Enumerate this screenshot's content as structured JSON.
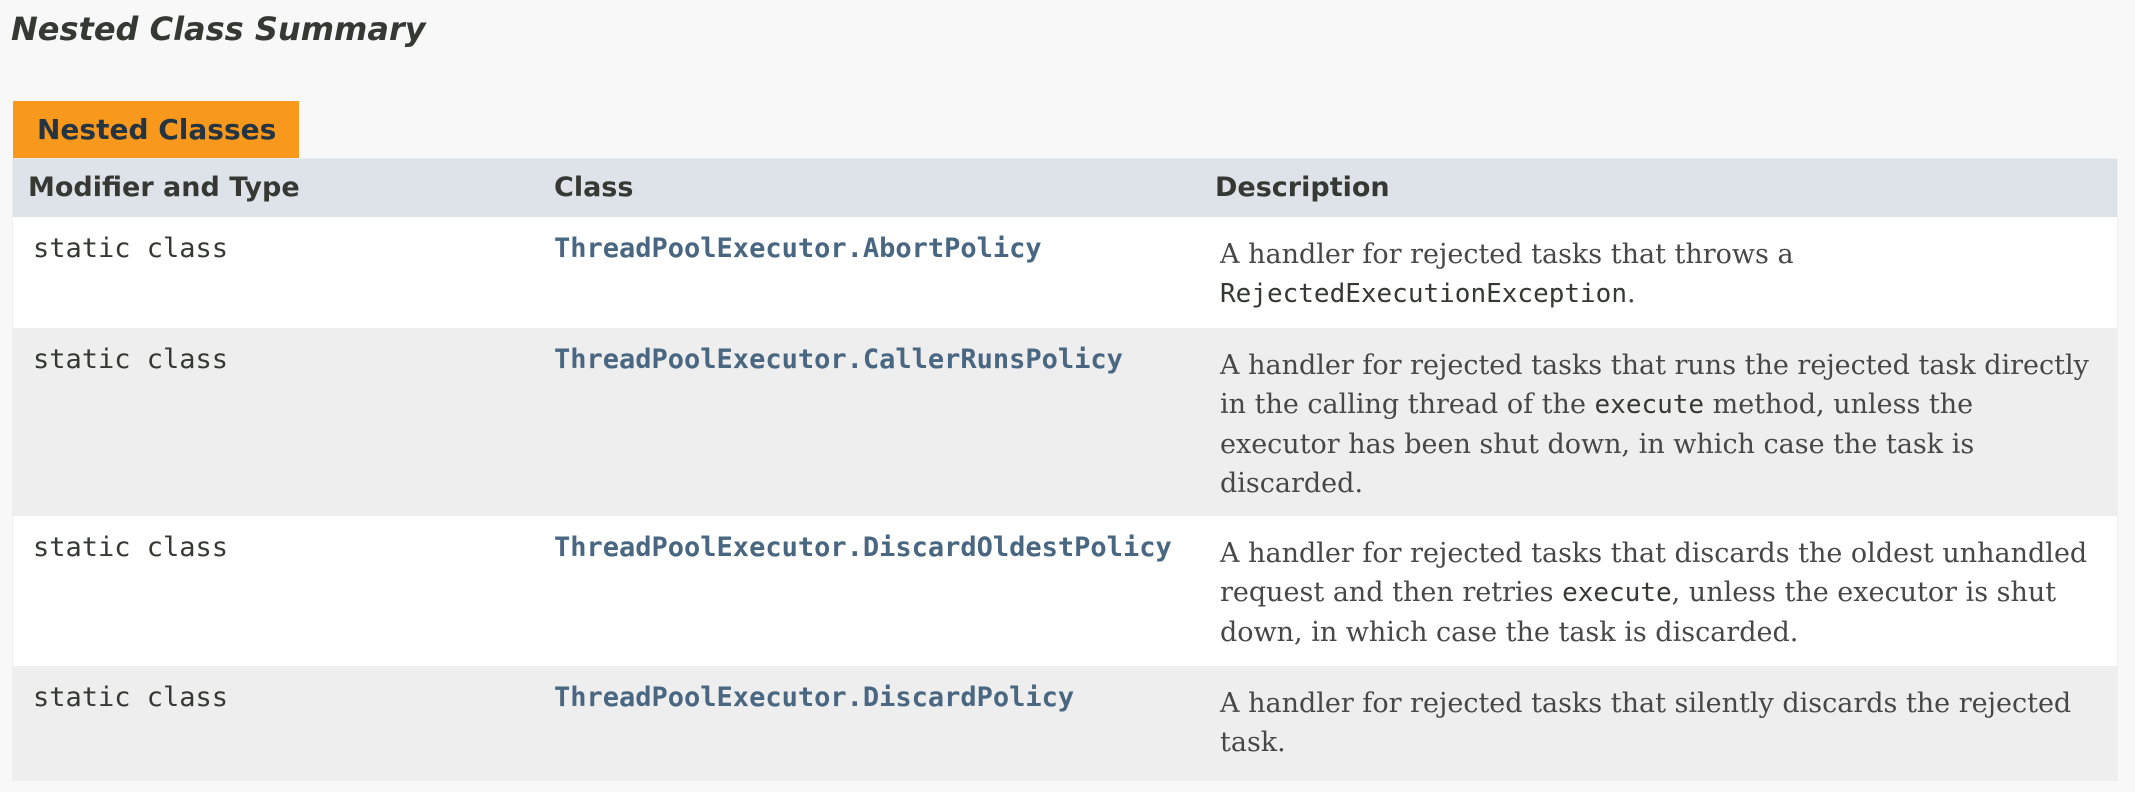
{
  "summary": {
    "title": "Nested Class Summary",
    "tab_label": "Nested Classes",
    "columns": {
      "modifier": "Modifier and Type",
      "class": "Class",
      "description": "Description"
    },
    "rows": [
      {
        "modifier": "static class",
        "class_name": "ThreadPoolExecutor.AbortPolicy",
        "desc": {
          "p1": "A handler for rejected tasks that throws a",
          "code1": "RejectedExecutionException",
          "p2": "."
        }
      },
      {
        "modifier": "static class",
        "class_name": "ThreadPoolExecutor.CallerRunsPolicy",
        "desc": {
          "p1": "A handler for rejected tasks that runs the rejected task directly in the calling thread of the ",
          "code1": "execute",
          "p2": " method, unless the executor has been shut down, in which case the task is discarded."
        }
      },
      {
        "modifier": "static class",
        "class_name": "ThreadPoolExecutor.DiscardOldestPolicy",
        "desc": {
          "p1": "A handler for rejected tasks that discards the oldest unhandled request and then retries ",
          "code1": "execute",
          "p2": ", unless the executor is shut down, in which case the task is discarded."
        }
      },
      {
        "modifier": "static class",
        "class_name": "ThreadPoolExecutor.DiscardPolicy",
        "desc": {
          "p1": "A handler for rejected tasks that silently discards the rejected task."
        }
      }
    ]
  },
  "colors": {
    "tab": "#f8981d",
    "header": "#dee3e9",
    "link": "#4a6782",
    "row_alt": "#eeeeef"
  }
}
